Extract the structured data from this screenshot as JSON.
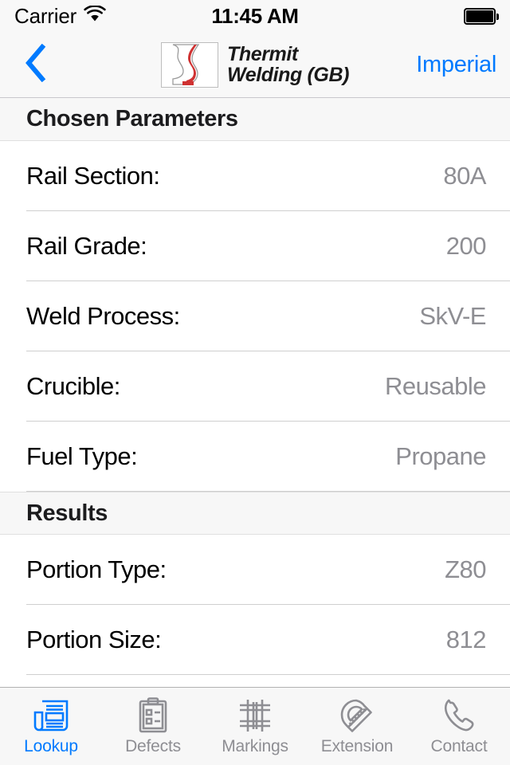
{
  "status_bar": {
    "carrier": "Carrier",
    "wifi_icon": "wifi-icon",
    "time": "11:45 AM",
    "battery_icon": "battery-full-icon"
  },
  "nav_bar": {
    "back_icon": "chevron-left-icon",
    "logo_icon": "thermit-rail-profile-logo",
    "brand_line1": "Thermit",
    "brand_line2": "Welding (GB)",
    "unit_toggle_label": "Imperial",
    "accent_color": "#007aff"
  },
  "sections": [
    {
      "title": "Chosen Parameters",
      "rows": [
        {
          "label": "Rail Section:",
          "value": "80A"
        },
        {
          "label": "Rail Grade:",
          "value": "200"
        },
        {
          "label": "Weld Process:",
          "value": "SkV-E"
        },
        {
          "label": "Crucible:",
          "value": "Reusable"
        },
        {
          "label": "Fuel Type:",
          "value": "Propane"
        }
      ]
    },
    {
      "title": "Results",
      "rows": [
        {
          "label": "Portion Type:",
          "value": "Z80"
        },
        {
          "label": "Portion Size:",
          "value": "812"
        }
      ]
    }
  ],
  "tab_bar": {
    "tabs": [
      {
        "label": "Lookup",
        "icon": "newspaper-icon",
        "active": true
      },
      {
        "label": "Defects",
        "icon": "clipboard-checklist-icon",
        "active": false
      },
      {
        "label": "Markings",
        "icon": "railroad-track-icon",
        "active": false
      },
      {
        "label": "Extension",
        "icon": "protractor-icon",
        "active": false
      },
      {
        "label": "Contact",
        "icon": "phone-handset-icon",
        "active": false
      }
    ],
    "active_color": "#007aff",
    "inactive_color": "#8e8e93"
  }
}
